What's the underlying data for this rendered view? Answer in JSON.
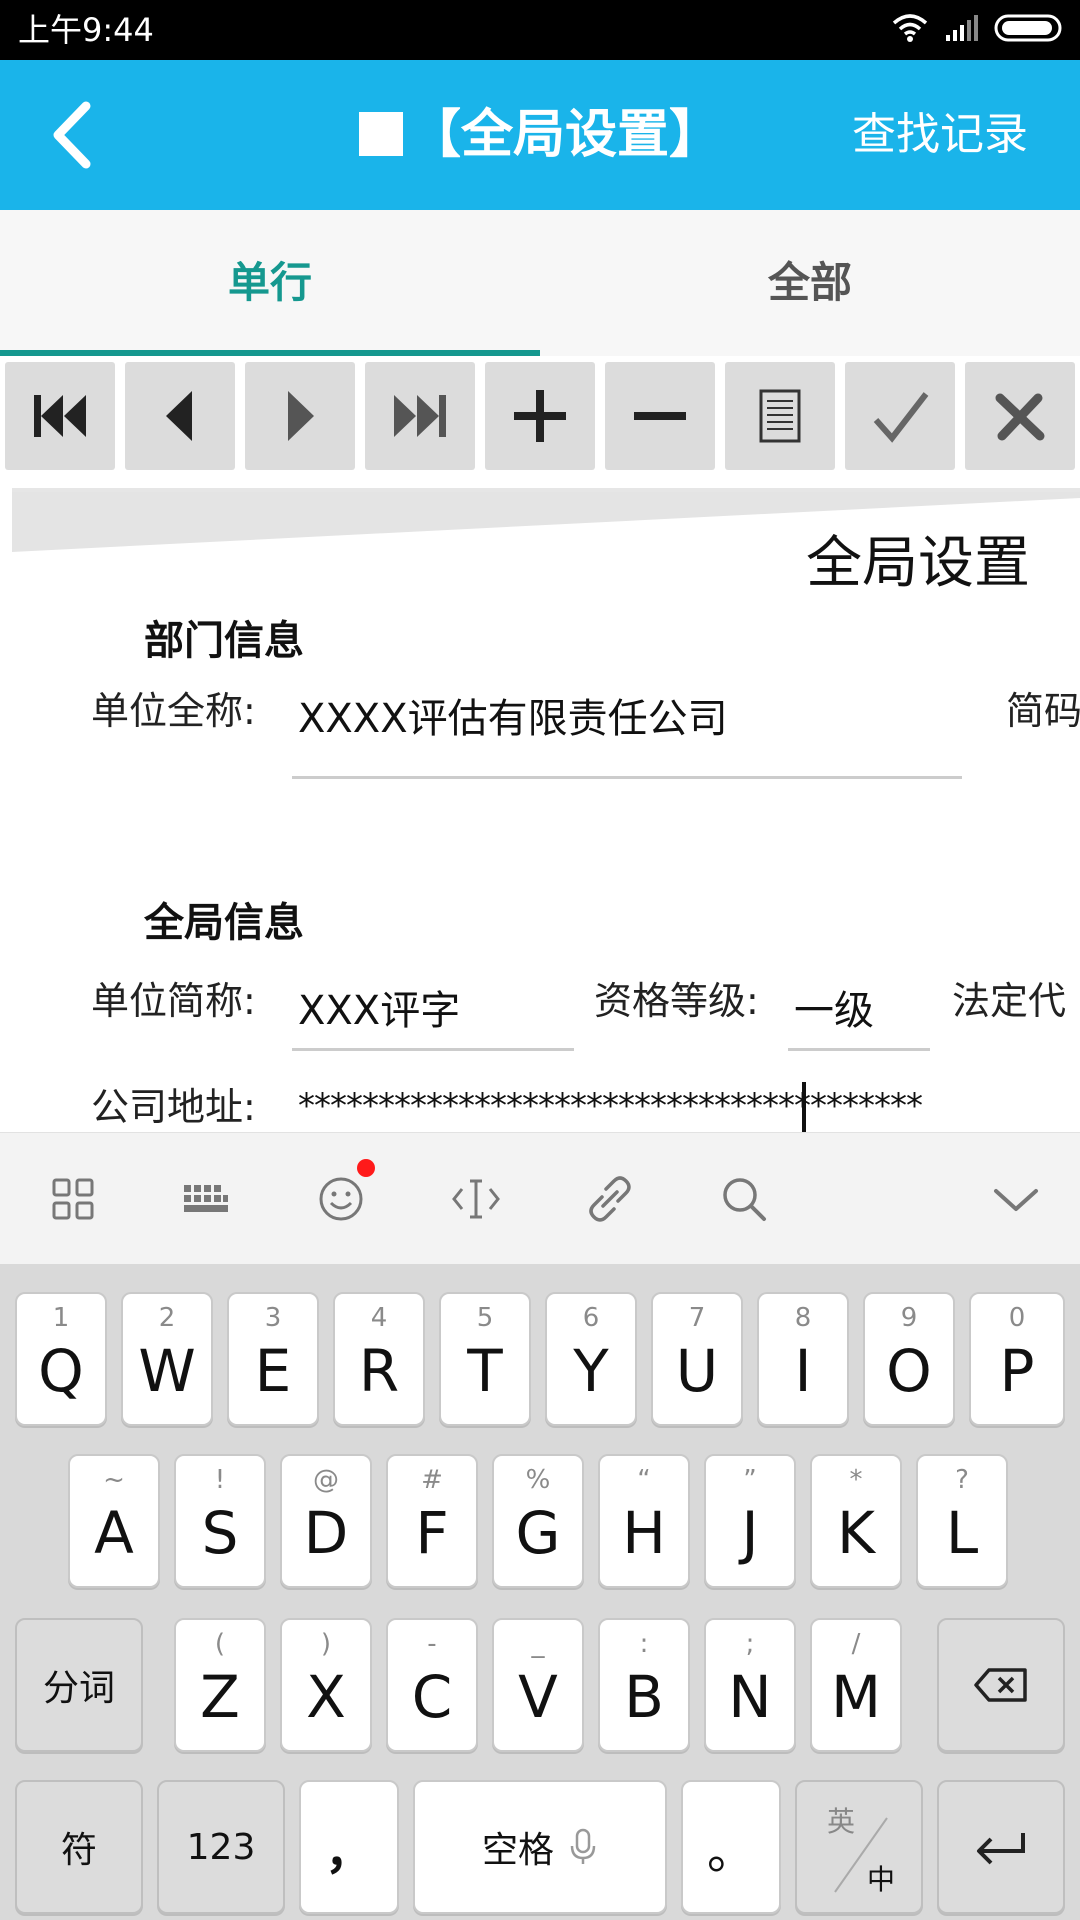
{
  "status_bar": {
    "time": "上午9:44"
  },
  "app_bar": {
    "title": "【全局设置】",
    "action_label": "查找记录"
  },
  "tabs": [
    {
      "label": "单行",
      "active": true
    },
    {
      "label": "全部",
      "active": false
    }
  ],
  "toolbar": {
    "buttons": [
      "first-icon",
      "prev-icon",
      "next-icon",
      "last-icon",
      "plus-icon",
      "minus-icon",
      "document-icon",
      "check-icon",
      "cancel-icon"
    ]
  },
  "form": {
    "title": "全局设置",
    "section1": "部门信息",
    "unit_fullname_label": "单位全称:",
    "unit_fullname_value": "XXXX评估有限责任公司",
    "short_code_label": "简码",
    "section2": "全局信息",
    "unit_short_label": "单位简称:",
    "unit_short_value": "XXX评字",
    "qual_label": "资格等级:",
    "qual_value": "一级",
    "legal_rep_label": "法定代",
    "address_label": "公司地址:",
    "address_value": "***************************************"
  },
  "keyboard_toolbar": [
    "grid-icon",
    "keyboard-icon",
    "emoji-icon",
    "cursor-icon",
    "link-icon",
    "search-icon",
    "collapse-icon"
  ],
  "keyboard": {
    "row1": [
      {
        "hint": "1",
        "ch": "Q"
      },
      {
        "hint": "2",
        "ch": "W"
      },
      {
        "hint": "3",
        "ch": "E"
      },
      {
        "hint": "4",
        "ch": "R"
      },
      {
        "hint": "5",
        "ch": "T"
      },
      {
        "hint": "6",
        "ch": "Y"
      },
      {
        "hint": "7",
        "ch": "U"
      },
      {
        "hint": "8",
        "ch": "I"
      },
      {
        "hint": "9",
        "ch": "O"
      },
      {
        "hint": "0",
        "ch": "P"
      }
    ],
    "row2": [
      {
        "hint": "~",
        "ch": "A"
      },
      {
        "hint": "!",
        "ch": "S"
      },
      {
        "hint": "@",
        "ch": "D"
      },
      {
        "hint": "#",
        "ch": "F"
      },
      {
        "hint": "%",
        "ch": "G"
      },
      {
        "hint": "“",
        "ch": "H"
      },
      {
        "hint": "”",
        "ch": "J"
      },
      {
        "hint": "*",
        "ch": "K"
      },
      {
        "hint": "?",
        "ch": "L"
      }
    ],
    "row3": [
      {
        "hint": "(",
        "ch": "Z"
      },
      {
        "hint": ")",
        "ch": "X"
      },
      {
        "hint": "-",
        "ch": "C"
      },
      {
        "hint": "_",
        "ch": "V"
      },
      {
        "hint": ":",
        "ch": "B"
      },
      {
        "hint": ";",
        "ch": "N"
      },
      {
        "hint": "/",
        "ch": "M"
      }
    ],
    "segment_label": "分词",
    "symbol_label": "符",
    "num_label": "123",
    "comma_label": "，",
    "space_label": "空格",
    "period_label": "。",
    "lang_top": "英",
    "lang_bottom": "中"
  }
}
